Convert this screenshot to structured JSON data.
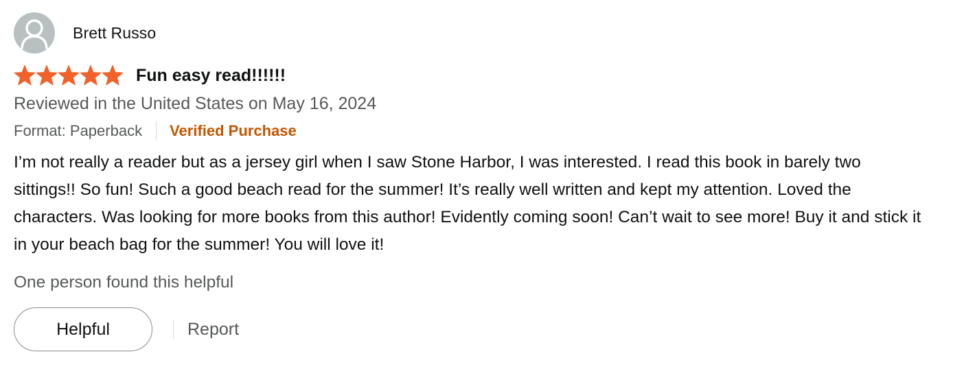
{
  "reviewer": {
    "name": "Brett Russo",
    "avatar_icon": "user-silhouette-icon"
  },
  "rating": {
    "stars": 5,
    "max_stars": 5,
    "star_color": "#f1612a",
    "title": "Fun easy read!!!!!!"
  },
  "review": {
    "date_line": "Reviewed in the United States on May 16, 2024",
    "format": "Format: Paperback",
    "verified": "Verified Purchase",
    "verified_color": "#c45500",
    "body": "I’m not really a reader but as a jersey girl when I saw Stone Harbor, I was interested. I read this book in barely two sittings!! So fun! Such a good beach read for the summer! It’s really well written and kept my attention. Loved the characters. Was looking for more books from this author! Evidently coming soon! Can’t wait to see more! Buy it and stick it in your beach bag for the summer! You will love it!"
  },
  "feedback": {
    "helpful_count_text": "One person found this helpful",
    "helpful_button": "Helpful",
    "report_link": "Report"
  }
}
